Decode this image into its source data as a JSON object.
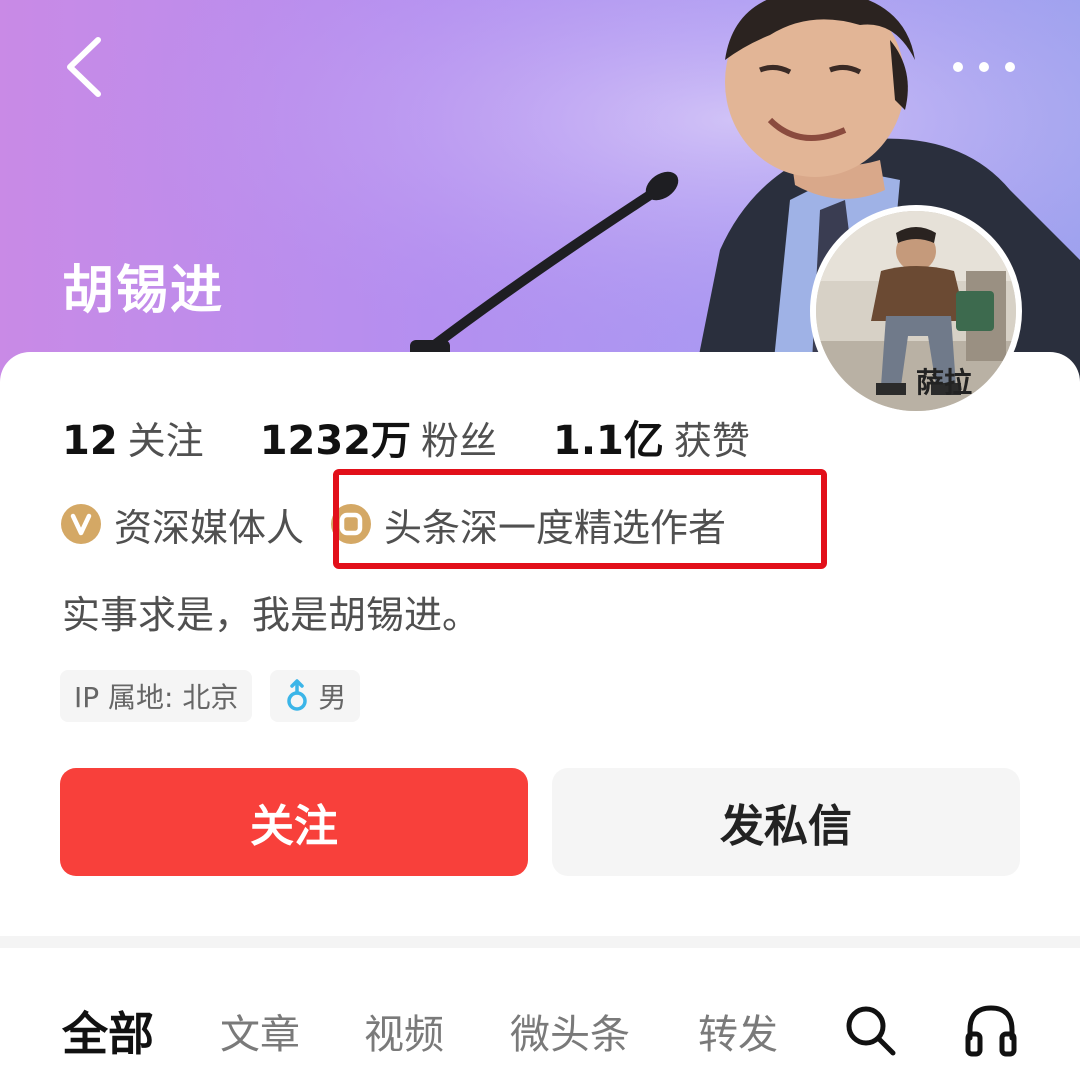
{
  "header": {
    "name": "胡锡进",
    "back_icon": "chevron-left-icon",
    "more_icon": "more-dots-icon",
    "photo_caption": "萨拉"
  },
  "stats": [
    {
      "value": "12",
      "label": "关注"
    },
    {
      "value": "1232万",
      "label": "粉丝"
    },
    {
      "value": "1.1亿",
      "label": "获赞"
    }
  ],
  "badges": [
    {
      "icon": "verified-v-icon",
      "label": "资深媒体人"
    },
    {
      "icon": "selected-author-icon",
      "label": "头条深一度精选作者"
    }
  ],
  "bio": "实事求是，我是胡锡进。",
  "tags": [
    {
      "label": "IP 属地: 北京"
    },
    {
      "icon": "male-gender-icon",
      "label": "男"
    }
  ],
  "actions": {
    "follow_label": "关注",
    "message_label": "发私信"
  },
  "tabs": [
    {
      "label": "全部",
      "active": true
    },
    {
      "label": "文章",
      "active": false
    },
    {
      "label": "视频",
      "active": false
    },
    {
      "label": "微头条",
      "active": false
    },
    {
      "label": "转发",
      "active": false
    }
  ],
  "tab_icons": [
    "search-icon",
    "headphones-icon"
  ],
  "colors": {
    "follow_button": "#f8403b",
    "highlight_box": "#e2101a",
    "badge_gold": "#d4a865",
    "gender_icon": "#3bb5e8"
  }
}
